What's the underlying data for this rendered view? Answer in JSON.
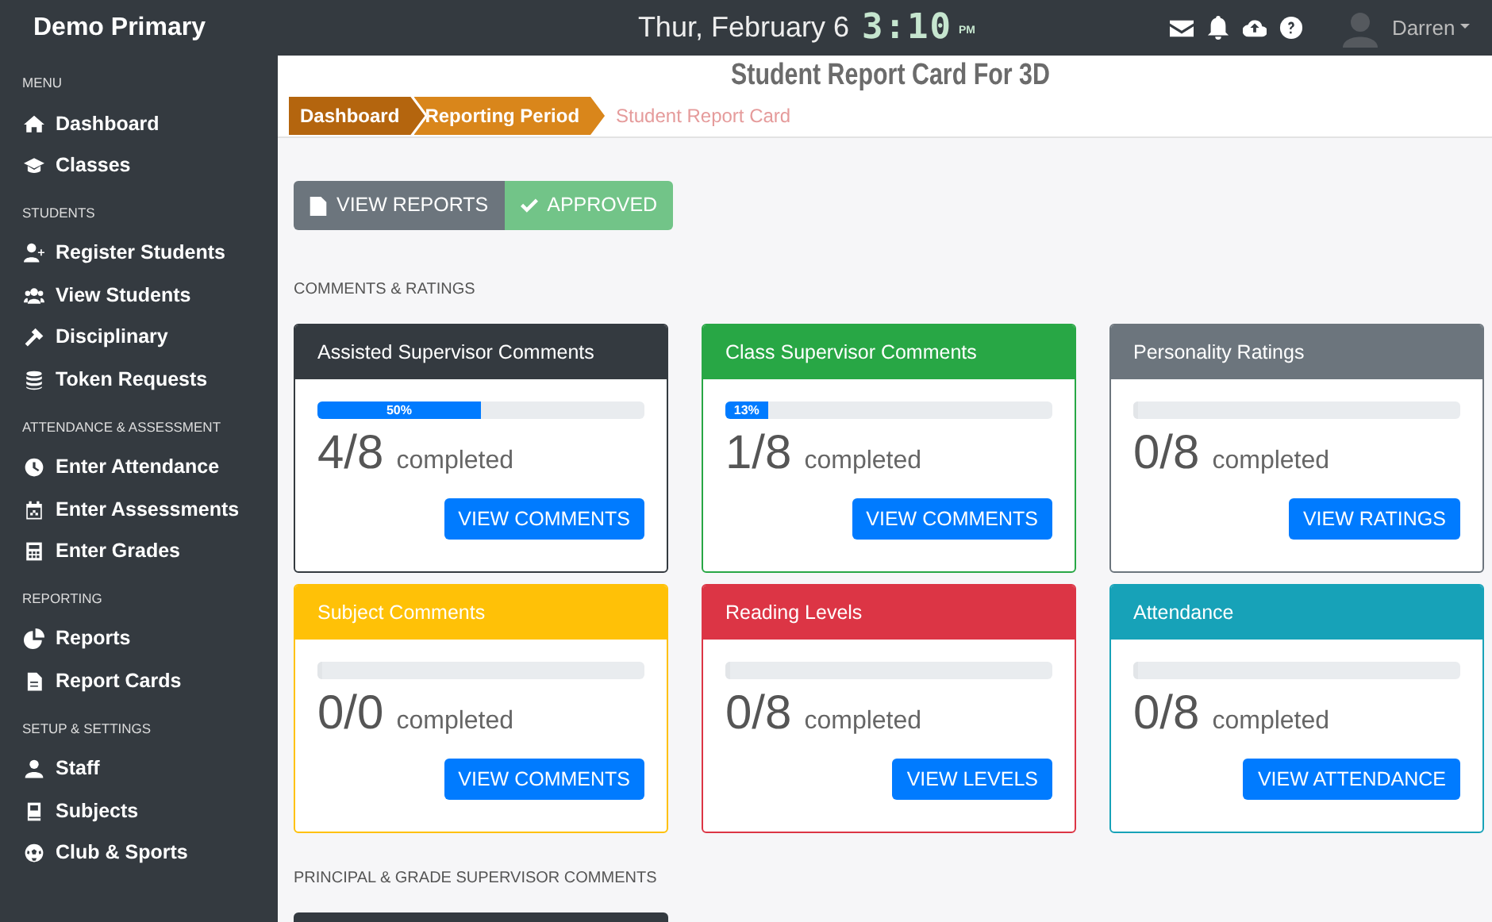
{
  "app": {
    "title": "Demo Primary",
    "date": "Thur, February 6",
    "time": "3:10",
    "meridiem": "PM",
    "user": "Darren"
  },
  "sidebar": [
    {
      "heading": "MENU",
      "items": [
        {
          "label": "Dashboard"
        },
        {
          "label": "Classes"
        }
      ]
    },
    {
      "heading": "STUDENTS",
      "items": [
        {
          "label": "Register Students"
        },
        {
          "label": "View Students"
        },
        {
          "label": "Disciplinary"
        },
        {
          "label": "Token Requests"
        }
      ]
    },
    {
      "heading": "ATTENDANCE & ASSESSMENT",
      "items": [
        {
          "label": "Enter Attendance"
        },
        {
          "label": "Enter Assessments"
        },
        {
          "label": "Enter Grades"
        }
      ]
    },
    {
      "heading": "REPORTING",
      "items": [
        {
          "label": "Reports"
        },
        {
          "label": "Report Cards"
        }
      ]
    },
    {
      "heading": "SETUP & SETTINGS",
      "items": [
        {
          "label": "Staff"
        },
        {
          "label": "Subjects"
        },
        {
          "label": "Club & Sports"
        }
      ]
    }
  ],
  "page_title": "Student Report Card For 3D",
  "breadcrumb": [
    {
      "label": "Dashboard",
      "color": "#b4650e"
    },
    {
      "label": "Reporting Period",
      "color": "#d9861b"
    },
    {
      "label": "Student Report Card"
    }
  ],
  "actions": [
    {
      "label": "VIEW REPORTS",
      "kind": "view"
    },
    {
      "label": "APPROVED",
      "kind": "approved"
    }
  ],
  "sections": [
    {
      "heading": "COMMENTS & RATINGS",
      "cards": [
        {
          "title": "Assisted Supervisor Comments",
          "color": "#343a40",
          "level": 0.5,
          "bar_label": "50%",
          "count": "4/8",
          "unit": "completed",
          "button": "VIEW COMMENTS"
        },
        {
          "title": "Class Supervisor Comments",
          "color": "#28a745",
          "level": 0.13,
          "bar_label": "13%",
          "count": "1/8",
          "unit": "completed",
          "button": "VIEW COMMENTS"
        },
        {
          "title": "Personality Ratings",
          "color": "#6c757d",
          "level": 0,
          "count": "0/8",
          "unit": "completed",
          "button": "VIEW RATINGS"
        },
        {
          "title": "Subject Comments",
          "color": "#ffc107",
          "level": 0,
          "count": "0/0",
          "unit": "completed",
          "button": "VIEW COMMENTS"
        },
        {
          "title": "Reading Levels",
          "color": "#dc3545",
          "level": 0,
          "count": "0/8",
          "unit": "completed",
          "button": "VIEW LEVELS"
        },
        {
          "title": "Attendance",
          "color": "#17a2b8",
          "level": 0,
          "count": "0/8",
          "unit": "completed",
          "button": "VIEW ATTENDANCE"
        }
      ]
    },
    {
      "heading": "PRINCIPAL & GRADE SUPERVISOR COMMENTS",
      "cards": [
        {
          "color": "#343a40"
        }
      ]
    }
  ]
}
